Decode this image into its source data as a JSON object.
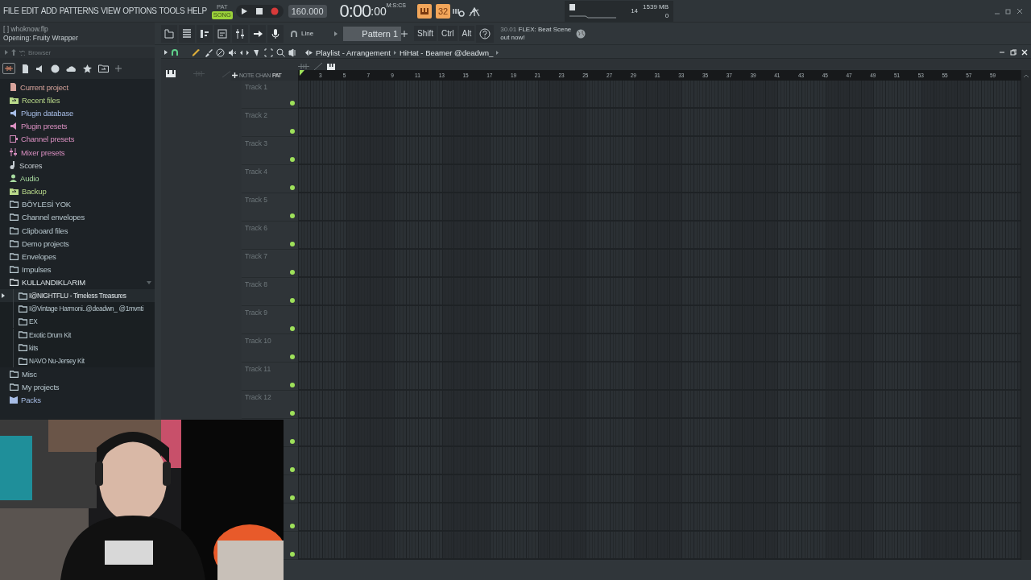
{
  "menu": [
    "FILE",
    "EDIT",
    "ADD",
    "PATTERNS",
    "VIEW",
    "OPTIONS",
    "TOOLS",
    "HELP"
  ],
  "transport": {
    "modes": [
      {
        "label": "PAT",
        "selected": false
      },
      {
        "label": "SONG",
        "selected": true
      }
    ],
    "recording": false,
    "tempo": "160.000",
    "time": "0:00",
    "time_cs": ":00",
    "time_unit": "M:S:CS"
  },
  "toggles": [
    {
      "label": "32",
      "on": true
    }
  ],
  "monitor": {
    "polyphony": "14",
    "memory": "1539 MB",
    "cpu": "0"
  },
  "hint": {
    "line_1": "[ ] whoknow.flp",
    "line_2": "Opening: Fruity Wrapper"
  },
  "snap": {
    "value": "Line"
  },
  "pattern": {
    "value": "Pattern 1"
  },
  "modifiers": [
    "Shift",
    "Ctrl",
    "Alt"
  ],
  "news": {
    "date": "30.01",
    "headline": "FLEX: Beat Scene",
    "tail": "out now!"
  },
  "browser": {
    "title": "Browser",
    "items": [
      {
        "label": "Current project",
        "kind": "file",
        "color": "#d8a49c"
      },
      {
        "label": "Recent files",
        "kind": "recent",
        "color": "#b9d98a"
      },
      {
        "label": "Plugin database",
        "kind": "plug",
        "color": "#a7bde6"
      },
      {
        "label": "Plugin presets",
        "kind": "plug",
        "color": "#d98fc0"
      },
      {
        "label": "Channel presets",
        "kind": "channel",
        "color": "#d98fc0"
      },
      {
        "label": "Mixer presets",
        "kind": "mixer",
        "color": "#d98fc0"
      },
      {
        "label": "Scores",
        "kind": "note",
        "color": "#c6cdd2"
      },
      {
        "label": "Audio",
        "kind": "person",
        "color": "#a8dba0"
      },
      {
        "label": "Backup",
        "kind": "recent",
        "color": "#b9d98a"
      },
      {
        "label": "BÖYLESİ YOK",
        "kind": "folder",
        "color": "#b8c8cf"
      },
      {
        "label": "Channel envelopes",
        "kind": "folder",
        "color": "#b8c8cf"
      },
      {
        "label": "Clipboard files",
        "kind": "folder",
        "color": "#b8c8cf"
      },
      {
        "label": "Demo projects",
        "kind": "folder",
        "color": "#b8c8cf"
      },
      {
        "label": "Envelopes",
        "kind": "folder",
        "color": "#b8c8cf"
      },
      {
        "label": "Impulses",
        "kind": "folder",
        "color": "#b8c8cf"
      },
      {
        "label": "KULLANDIKLARIM",
        "kind": "folder",
        "color": "#dfe6ea",
        "expanded": true,
        "children": [
          {
            "label": "I@NIGHTFLU - Timeless Treasures",
            "selected": true
          },
          {
            "label": "I@Vintage Harmoni..@deadwn_ @1mvnti",
            "selected": false
          },
          {
            "label": "EX",
            "selected": false
          },
          {
            "label": "Exotic Drum Kit",
            "selected": false
          },
          {
            "label": "kits",
            "selected": false
          },
          {
            "label": "NAVO Nu-Jersey Kit",
            "selected": false
          }
        ]
      },
      {
        "label": "Misc",
        "kind": "folder",
        "color": "#b8c8cf"
      },
      {
        "label": "My projects",
        "kind": "folder",
        "color": "#b8c8cf"
      },
      {
        "label": "Packs",
        "kind": "packs",
        "color": "#a7bde6"
      }
    ]
  },
  "playlist": {
    "title": "Playlist - Arrangement",
    "pattern": "HiHat - Beamer @deadwn_",
    "views": [
      {
        "label": "NOTE",
        "selected": false
      },
      {
        "label": "CHAN",
        "selected": false
      },
      {
        "label": "PAT",
        "selected": true
      }
    ],
    "ruler": [
      "3",
      "5",
      "7",
      "9",
      "11",
      "13",
      "15",
      "17",
      "19",
      "21",
      "23",
      "25",
      "27",
      "29",
      "31",
      "33",
      "35",
      "37",
      "39",
      "41",
      "43",
      "45",
      "47",
      "49",
      "51",
      "53",
      "55",
      "57",
      "59"
    ],
    "tracks": [
      {
        "name": "Track 1",
        "enabled": true
      },
      {
        "name": "Track 2",
        "enabled": true
      },
      {
        "name": "Track 3",
        "enabled": true
      },
      {
        "name": "Track 4",
        "enabled": true
      },
      {
        "name": "Track 5",
        "enabled": true
      },
      {
        "name": "Track 6",
        "enabled": true
      },
      {
        "name": "Track 7",
        "enabled": true
      },
      {
        "name": "Track 8",
        "enabled": true
      },
      {
        "name": "Track 9",
        "enabled": true
      },
      {
        "name": "Track 10",
        "enabled": true
      },
      {
        "name": "Track 11",
        "enabled": true
      },
      {
        "name": "Track 12",
        "enabled": true
      },
      {
        "enabled": true
      },
      {
        "enabled": true
      },
      {
        "enabled": true
      },
      {
        "enabled": true
      },
      {
        "enabled": true
      }
    ]
  }
}
